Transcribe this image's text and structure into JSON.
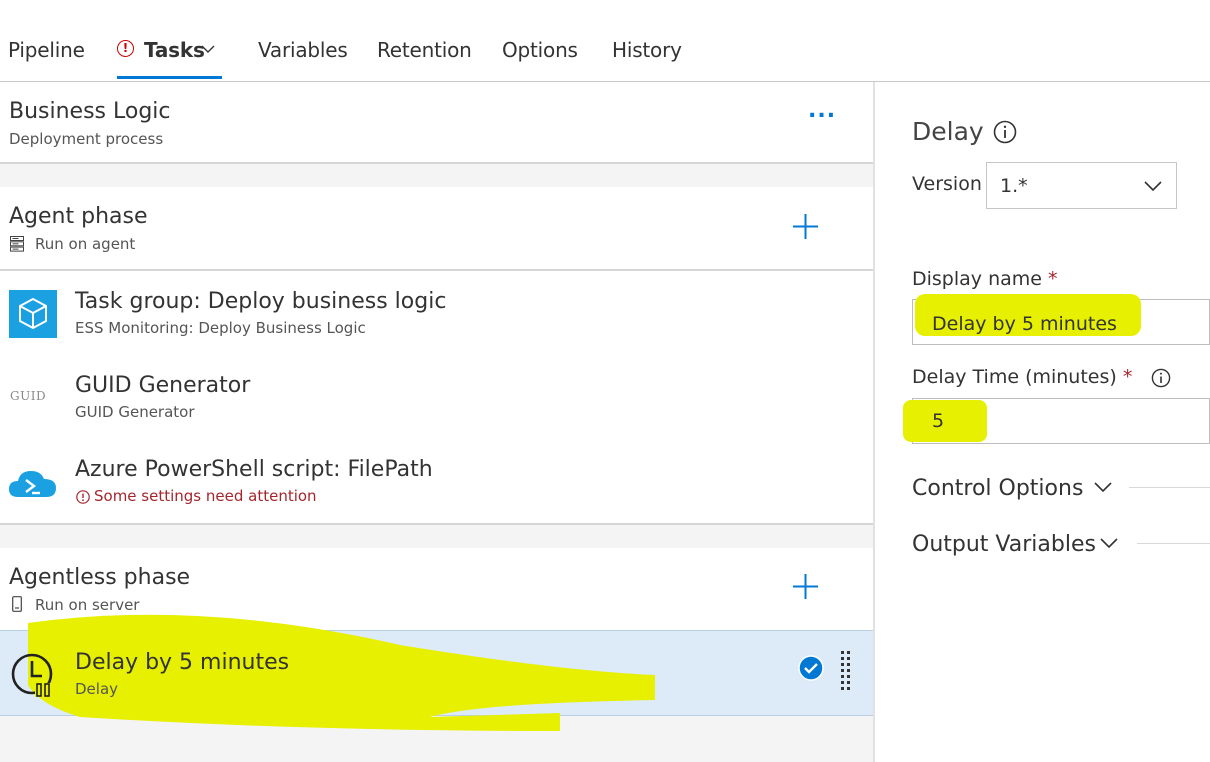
{
  "tabs": [
    {
      "label": "Pipeline"
    },
    {
      "label": "Tasks",
      "active": true,
      "has_alert": true
    },
    {
      "label": "Variables"
    },
    {
      "label": "Retention"
    },
    {
      "label": "Options"
    },
    {
      "label": "History"
    }
  ],
  "process": {
    "title": "Business Logic",
    "subtitle": "Deployment process",
    "more_label": "..."
  },
  "agent_phase": {
    "title": "Agent phase",
    "subtitle": "Run on agent"
  },
  "tasks": [
    {
      "title": "Task group: Deploy business logic",
      "subtitle": "ESS Monitoring: Deploy Business Logic",
      "icon": "task-group-icon"
    },
    {
      "title": "GUID Generator",
      "subtitle": "GUID Generator",
      "icon": "guid-icon",
      "icon_text": "GUID"
    },
    {
      "title": "Azure PowerShell script: FilePath",
      "subtitle": "Some settings need attention",
      "icon": "azure-powershell-icon",
      "warning": true
    }
  ],
  "agentless_phase": {
    "title": "Agentless phase",
    "subtitle": "Run on server"
  },
  "selected_task": {
    "title": "Delay by 5 minutes",
    "subtitle": "Delay",
    "icon": "delay-clock-icon"
  },
  "panel": {
    "title": "Delay",
    "version_label": "Version",
    "version_value": "1.*",
    "display_name_label": "Display name",
    "required_marker": "*",
    "display_name_value": "Delay by 5 minutes",
    "delay_time_label": "Delay Time (minutes)",
    "delay_time_value": "5",
    "control_options_label": "Control Options",
    "output_variables_label": "Output Variables"
  },
  "colors": {
    "accent": "#0078d4",
    "selected_bg": "#dcebf7",
    "highlight": "#e6f000",
    "error": "#a4262c",
    "azure": "#1ba1e2"
  }
}
